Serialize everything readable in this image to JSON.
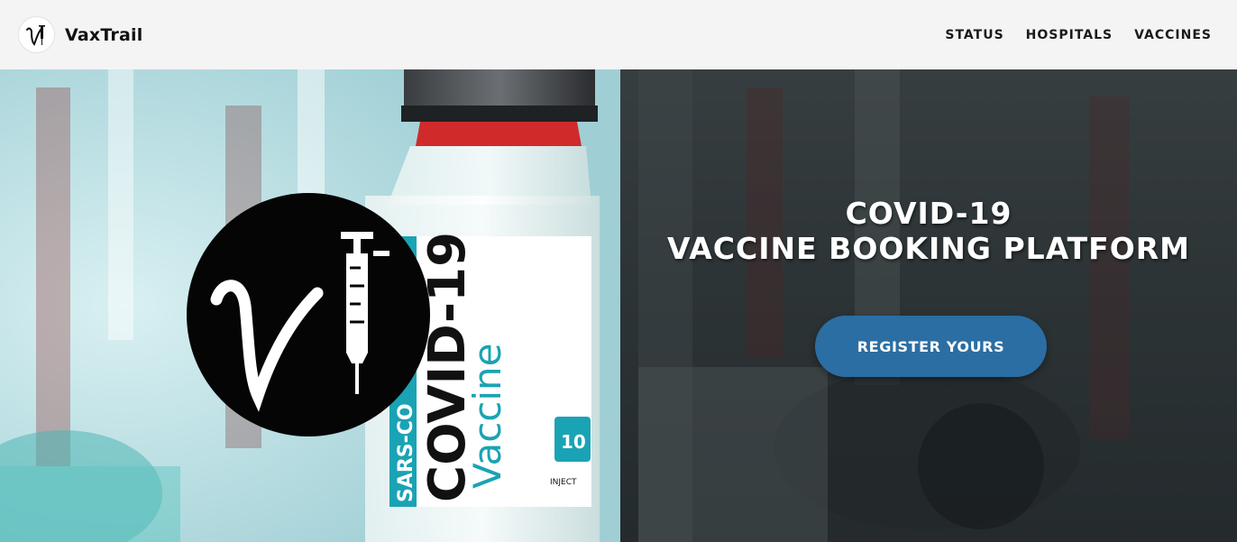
{
  "header": {
    "brand_name": "VaxTrail",
    "nav": [
      {
        "label": "STATUS"
      },
      {
        "label": "HOSPITALS"
      },
      {
        "label": "VACCINES"
      }
    ]
  },
  "hero": {
    "vial_label": {
      "prefix": "SARS-CO",
      "title": "COVID-19",
      "subtitle": "Vaccine",
      "dose": "10",
      "note": "INJECT"
    },
    "headline_line1": "COVID-19",
    "headline_line2": "VACCINE BOOKING PLATFORM",
    "cta_label": "REGISTER YOURS"
  },
  "colors": {
    "accent_button": "#2b6ea3",
    "teal_label": "#1aa3b4",
    "vial_cap_red": "#d12a2a"
  },
  "icons": [
    "vaxtrail-logo-icon",
    "syringe-icon"
  ]
}
